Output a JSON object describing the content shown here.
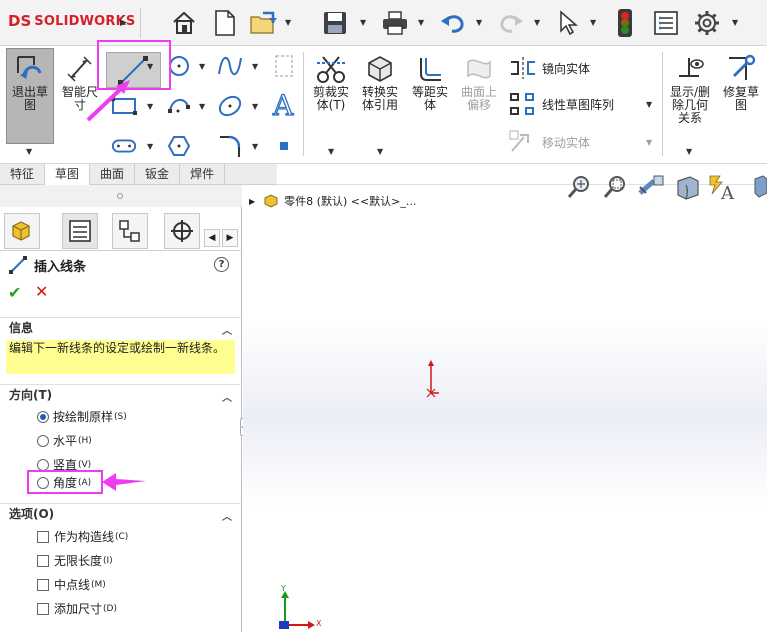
{
  "app": {
    "logo_text": "SOLIDWORKS",
    "logo_mark": "DS"
  },
  "quick_access": {
    "buttons": [
      "home-icon",
      "new-document-icon",
      "open-icon",
      "save-icon",
      "print-icon",
      "undo-icon",
      "redo-icon",
      "select-icon",
      "rebuild-icon",
      "file-properties-icon",
      "options-icon"
    ]
  },
  "command_manager": {
    "exit_sketch": "退出草\n图",
    "smart_dimension": "智能尺\n寸",
    "trim": "剪裁实\n体(T)",
    "convert": "转换实\n体引用",
    "offset": "等距实\n体",
    "offset_on_surface": "曲面上\n偏移",
    "mirror": "镜向实体",
    "linear_pattern": "线性草图阵列",
    "move": "移动实体",
    "show_relations": "显示/删\n除几何\n关系",
    "repair_sketch": "修复草\n图"
  },
  "tabs": [
    "特征",
    "草图",
    "曲面",
    "钣金",
    "焊件"
  ],
  "active_tab": 1,
  "property_manager": {
    "title": "插入线条",
    "help": "?",
    "info": {
      "header": "信息",
      "text": "编辑下一新线条的设定或绘制一新线条。"
    },
    "orientation": {
      "header": "方向(T)",
      "options": [
        {
          "label": "按绘制原样",
          "key": "(S)",
          "checked": true
        },
        {
          "label": "水平",
          "key": "(H)",
          "checked": false
        },
        {
          "label": "竖直",
          "key": "(V)",
          "checked": false
        },
        {
          "label": "角度",
          "key": "(A)",
          "checked": false
        }
      ]
    },
    "options": {
      "header": "选项(O)",
      "items": [
        {
          "label": "作为构造线",
          "key": "(C)",
          "checked": false
        },
        {
          "label": "无限长度",
          "key": "(I)",
          "checked": false
        },
        {
          "label": "中点线",
          "key": "(M)",
          "checked": false
        },
        {
          "label": "添加尺寸",
          "key": "(D)",
          "checked": false
        }
      ]
    }
  },
  "feature_tree": {
    "root": "零件8 (默认) <<默认>_..."
  },
  "triad": {
    "x": "X",
    "y": "Y",
    "z": "Z"
  },
  "colors": {
    "accent": "#f03cf0",
    "logo": "#d4202a",
    "info_bg": "#ffff91",
    "origin": "#d01818"
  }
}
